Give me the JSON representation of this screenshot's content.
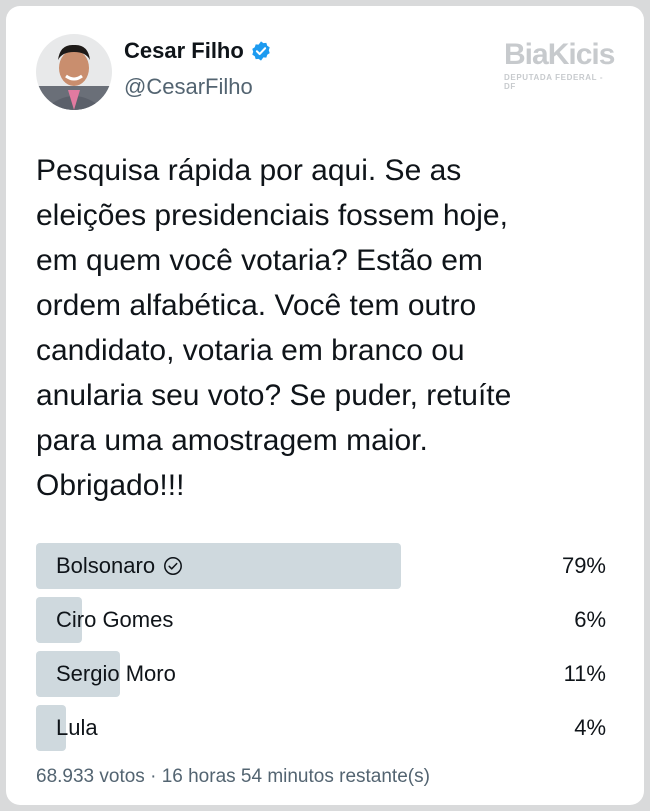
{
  "author": {
    "name": "Cesar Filho",
    "handle": "@CesarFilho",
    "verified": true,
    "avatar_icon": "avatar-photo"
  },
  "watermark": {
    "brand_part1": "Bia",
    "brand_part2": "Kicis",
    "subtitle": "DEPUTADA FEDERAL - DF"
  },
  "tweet": {
    "text": "Pesquisa rápida por aqui. Se as\neleições presidenciais fossem hoje,\nem quem você votaria? Estão em\nordem alfabética. Você tem outro\ncandidato, votaria em branco ou\nanularia seu voto? Se puder, retuíte\npara uma amostragem maior.\nObrigado!!!"
  },
  "poll": {
    "options": [
      {
        "label": "Bolsonaro",
        "percent_label": "79%",
        "percent": 79,
        "winner": true
      },
      {
        "label": "Ciro Gomes",
        "percent_label": "6%",
        "percent": 6,
        "winner": false
      },
      {
        "label": "Sergio Moro",
        "percent_label": "11%",
        "percent": 11,
        "winner": false
      },
      {
        "label": "Lula",
        "percent_label": "4%",
        "percent": 4,
        "winner": false
      }
    ],
    "footer": "68.933 votos · 16 horas 54 minutos restante(s)"
  },
  "colors": {
    "bar": "#cfd9de",
    "verified": "#1d9bf0",
    "text": "#0f1419",
    "muted": "#536471"
  }
}
